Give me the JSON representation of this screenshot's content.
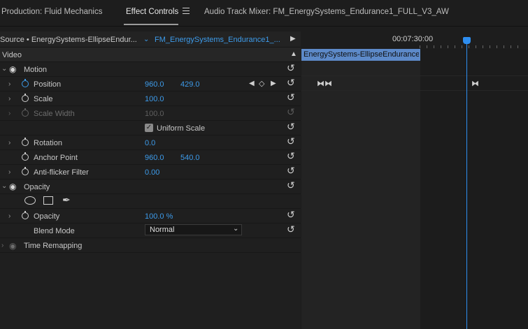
{
  "tabs": [
    {
      "label": "Production: Fluid Mechanics",
      "active": false
    },
    {
      "label": "Effect Controls",
      "active": true
    },
    {
      "label": "Audio Track Mixer: FM_EnergySystems_Endurance1_FULL_V3_AW",
      "active": false
    }
  ],
  "source_row": {
    "source": "Source • EnergySystems-EllipseEndur...",
    "sequence": "FM_EnergySystems_Endurance1_...",
    "timecode": "00:07:30:00"
  },
  "section": {
    "label": "Video"
  },
  "clip": {
    "label": "EnergySystems-EllipseEndurance-"
  },
  "motion": {
    "label": "Motion",
    "position": {
      "label": "Position",
      "x": "960.0",
      "y": "429.0"
    },
    "scale": {
      "label": "Scale",
      "value": "100.0"
    },
    "scale_width": {
      "label": "Scale Width",
      "value": "100.0"
    },
    "uniform_scale": {
      "label": "Uniform Scale",
      "checked": true
    },
    "rotation": {
      "label": "Rotation",
      "value": "0.0"
    },
    "anchor_point": {
      "label": "Anchor Point",
      "x": "960.0",
      "y": "540.0"
    },
    "anti_flicker": {
      "label": "Anti-flicker Filter",
      "value": "0.00"
    }
  },
  "opacity": {
    "label": "Opacity",
    "opacity_param": {
      "label": "Opacity",
      "value": "100.0 %"
    },
    "blend_mode": {
      "label": "Blend Mode",
      "value": "Normal"
    }
  },
  "time_remapping": {
    "label": "Time Remapping"
  },
  "colors": {
    "accent": "#3d9bea",
    "clip": "#5d8ac9",
    "playhead": "#2e8ef0"
  }
}
